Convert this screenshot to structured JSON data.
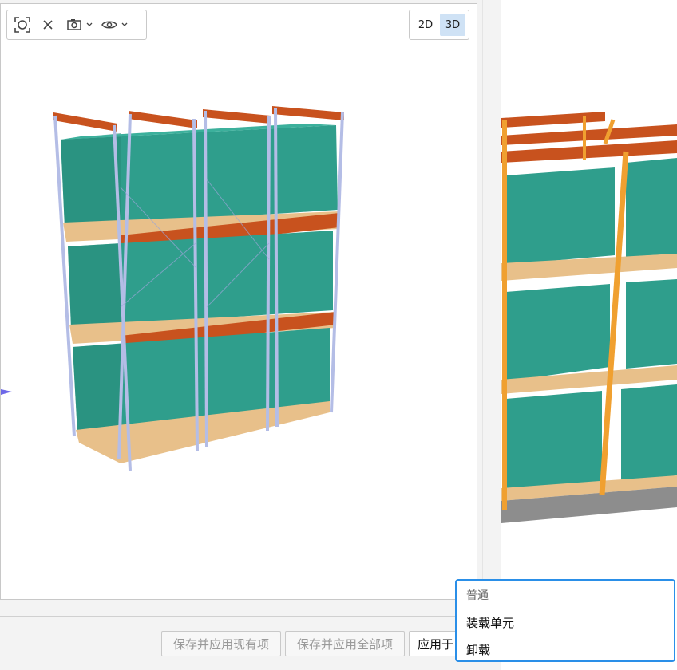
{
  "toolbar": {
    "icons": [
      "fit-view-icon",
      "close-icon",
      "camera-icon",
      "chevron-down-icon",
      "eye-icon",
      "chevron-down-icon"
    ]
  },
  "view_mode": {
    "options": [
      "2D",
      "3D"
    ],
    "active": "3D"
  },
  "footer": {
    "save_apply_existing": "保存并应用现有项",
    "save_apply_all": "保存并应用全部项",
    "apply_to": "应用于"
  },
  "dropdown": {
    "header": "普通",
    "items": [
      "装载单元",
      "卸载"
    ]
  },
  "colors": {
    "pallet_box": "#2f9e8c",
    "beam": "#c8521e",
    "upright_left": "#b4bde6",
    "upright_right": "#f0a030",
    "pallet_wood": "#e8c08a",
    "accent": "#2a8fe8",
    "active_mode_bg": "#cfe2f5"
  }
}
